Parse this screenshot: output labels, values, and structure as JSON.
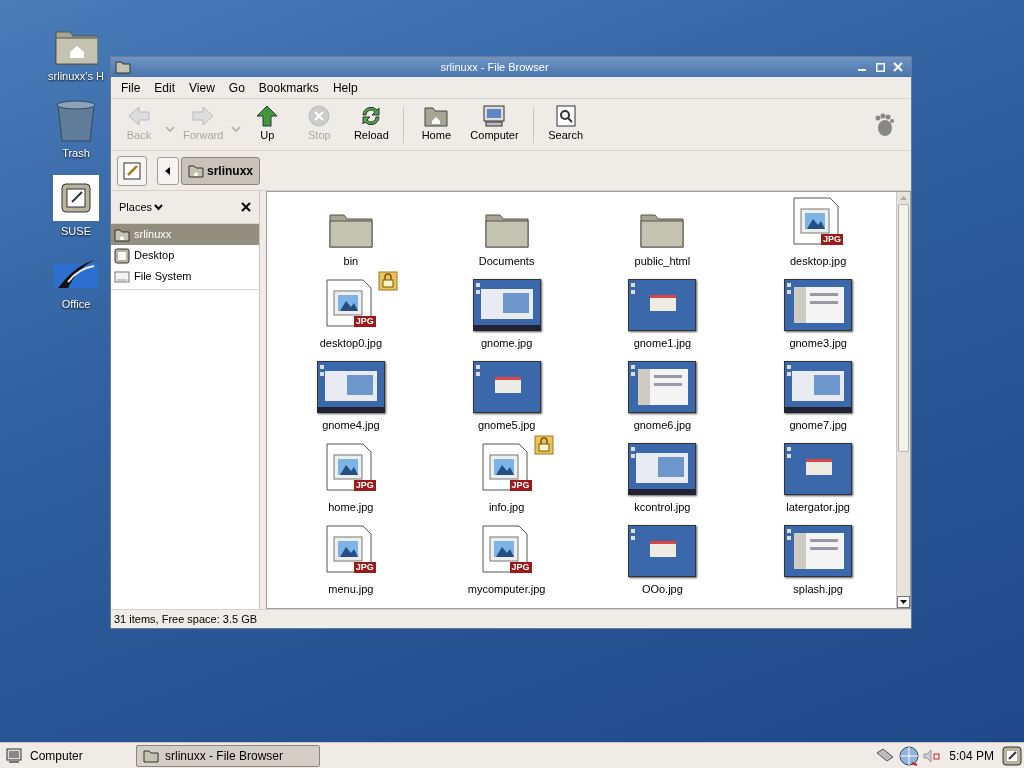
{
  "desktop_icons": [
    {
      "kind": "home",
      "label": "srlinuxx's H"
    },
    {
      "kind": "trash",
      "label": "Trash"
    },
    {
      "kind": "note",
      "label": "SUSE",
      "selected": true
    },
    {
      "kind": "office",
      "label": "Office"
    }
  ],
  "window": {
    "title": "srlinuxx - File Browser"
  },
  "menu": [
    "File",
    "Edit",
    "View",
    "Go",
    "Bookmarks",
    "Help"
  ],
  "toolbar": [
    {
      "kind": "back",
      "label": "Back",
      "disabled": true,
      "dropdown": true
    },
    {
      "kind": "forward",
      "label": "Forward",
      "disabled": true,
      "dropdown": true
    },
    {
      "kind": "up",
      "label": "Up",
      "disabled": false
    },
    {
      "kind": "stop",
      "label": "Stop",
      "disabled": true
    },
    {
      "kind": "reload",
      "label": "Reload",
      "disabled": false
    },
    {
      "kind": "home",
      "label": "Home",
      "disabled": false,
      "separator_before": true
    },
    {
      "kind": "computer",
      "label": "Computer",
      "disabled": false
    },
    {
      "kind": "search",
      "label": "Search",
      "disabled": false,
      "separator_before": true
    }
  ],
  "location": {
    "path_button": "srlinuxx"
  },
  "sidebar": {
    "title": "Places",
    "items": [
      {
        "kind": "home",
        "label": "srlinuxx",
        "selected": true
      },
      {
        "kind": "desktop",
        "label": "Desktop",
        "selected": false
      },
      {
        "kind": "drive",
        "label": "File System",
        "selected": false
      }
    ]
  },
  "files": [
    {
      "kind": "folder",
      "name": "bin",
      "locked": false
    },
    {
      "kind": "folder",
      "name": "Documents",
      "locked": false
    },
    {
      "kind": "folder",
      "name": "public_html",
      "locked": false
    },
    {
      "kind": "jpg",
      "name": "desktop.jpg",
      "badge": "JPG",
      "locked": false
    },
    {
      "kind": "jpg",
      "name": "desktop0.jpg",
      "badge": "JPG",
      "locked": true
    },
    {
      "kind": "thumbnail",
      "name": "gnome.jpg",
      "locked": false
    },
    {
      "kind": "thumbnail",
      "name": "gnome1.jpg",
      "locked": false
    },
    {
      "kind": "thumbnail",
      "name": "gnome3.jpg",
      "locked": false
    },
    {
      "kind": "thumbnail",
      "name": "gnome4.jpg",
      "locked": false
    },
    {
      "kind": "thumbnail",
      "name": "gnome5.jpg",
      "locked": false
    },
    {
      "kind": "thumbnail",
      "name": "gnome6.jpg",
      "locked": false
    },
    {
      "kind": "thumbnail",
      "name": "gnome7.jpg",
      "locked": false
    },
    {
      "kind": "jpg",
      "name": "home.jpg",
      "badge": "JPG",
      "locked": false
    },
    {
      "kind": "jpg",
      "name": "info.jpg",
      "badge": "JPG",
      "locked": true
    },
    {
      "kind": "thumbnail",
      "name": "kcontrol.jpg",
      "locked": false
    },
    {
      "kind": "thumbnail",
      "name": "latergator.jpg",
      "locked": false
    },
    {
      "kind": "jpg",
      "name": "menu.jpg",
      "badge": "JPG",
      "locked": false
    },
    {
      "kind": "jpg",
      "name": "mycomputer.jpg",
      "badge": "JPG",
      "locked": false
    },
    {
      "kind": "thumbnail",
      "name": "OOo.jpg",
      "locked": false
    },
    {
      "kind": "thumbnail",
      "name": "splash.jpg",
      "locked": false
    }
  ],
  "status_bar": "31 items, Free space: 3.5 GB",
  "taskbar": {
    "menu_button": "Computer",
    "windows": [
      {
        "label": "srlinuxx - File Browser",
        "selected": true
      }
    ],
    "clock": "5:04 PM"
  }
}
